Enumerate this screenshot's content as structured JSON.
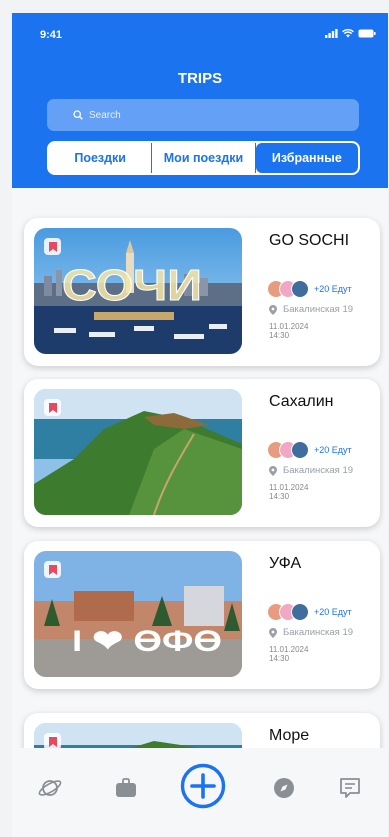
{
  "status": {
    "time": "9:41"
  },
  "header": {
    "title": "TRIPS"
  },
  "search": {
    "placeholder": "Search"
  },
  "tabs": [
    {
      "label": "Поездки",
      "selected": false
    },
    {
      "label": "Мои поездки",
      "selected": false
    },
    {
      "label": "Избранные",
      "selected": true
    }
  ],
  "trips": [
    {
      "name": "GO SOCHI",
      "going": "+20 Едут",
      "location": "Бакалинская 19",
      "date": "11.01.2024",
      "time": "14:30",
      "photo_text": "СОЧИ"
    },
    {
      "name": "Сахалин",
      "going": "+20 Едут",
      "location": "Бакалинская 19",
      "date": "11.01.2024",
      "time": "14:30"
    },
    {
      "name": "УФА",
      "going": "+20 Едут",
      "location": "Бакалинская 19",
      "date": "11.01.2024",
      "time": "14:30",
      "photo_text": "I ❤ ӨФӨ"
    },
    {
      "name": "Море"
    }
  ],
  "bottom_nav": [
    {
      "icon": "planet-icon"
    },
    {
      "icon": "briefcase-icon"
    },
    {
      "icon": "add-circle-icon"
    },
    {
      "icon": "compass-icon"
    },
    {
      "icon": "chat-icon"
    }
  ],
  "colors": {
    "accent": "#1b73f0",
    "bookmark": "#e8495f"
  }
}
